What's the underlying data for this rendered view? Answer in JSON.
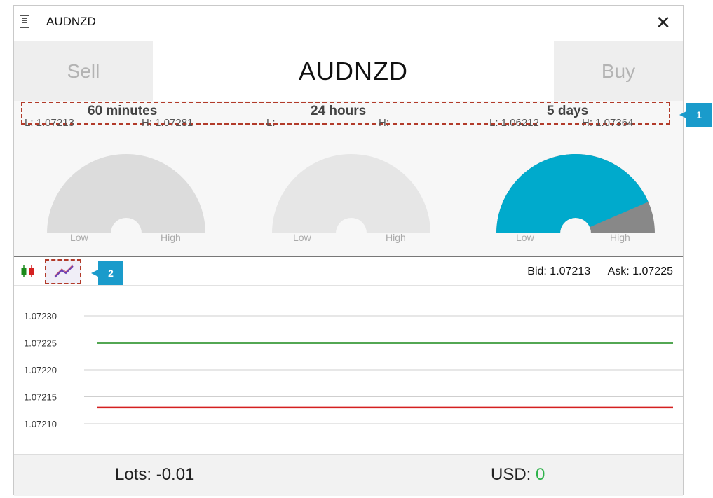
{
  "window": {
    "title": "AUDNZD",
    "close_glyph": "✕"
  },
  "trade": {
    "sell_label": "Sell",
    "symbol": "AUDNZD",
    "buy_label": "Buy"
  },
  "ranges": [
    {
      "label": "60 minutes",
      "low": "L: 1.07213",
      "high": "H: 1.07281",
      "position": 0.0,
      "color": "#888888"
    },
    {
      "label": "24 hours",
      "low": "L:",
      "high": "H:",
      "position": null,
      "color": "#e6e6e6"
    },
    {
      "label": "5 days",
      "low": "L: 1.06212",
      "high": "H: 1.07364",
      "position": 0.87,
      "color": "#00aacc"
    }
  ],
  "gauge_labels": {
    "low": "Low",
    "high": "High"
  },
  "toolbar": {
    "candles_icon": "candlestick-chart-icon",
    "line_icon": "line-chart-icon",
    "bid": "Bid: 1.07213",
    "ask": "Ask: 1.07225"
  },
  "chart_data": {
    "type": "line",
    "y_ticks": [
      "1.07230",
      "1.07225",
      "1.07220",
      "1.07215",
      "1.07210"
    ],
    "ylim": [
      1.07208,
      1.07232
    ],
    "series": [
      {
        "name": "Ask",
        "value": 1.07225,
        "color": "#1a8a1a"
      },
      {
        "name": "Bid",
        "value": 1.07213,
        "color": "#d42020"
      }
    ]
  },
  "footer": {
    "lots": "Lots: -0.01",
    "usd_label": "USD:",
    "usd_value": "0"
  },
  "callouts": {
    "one": "1",
    "two": "2"
  },
  "colors": {
    "accent": "#1a9bcb",
    "callout_border": "#b23b2a"
  }
}
